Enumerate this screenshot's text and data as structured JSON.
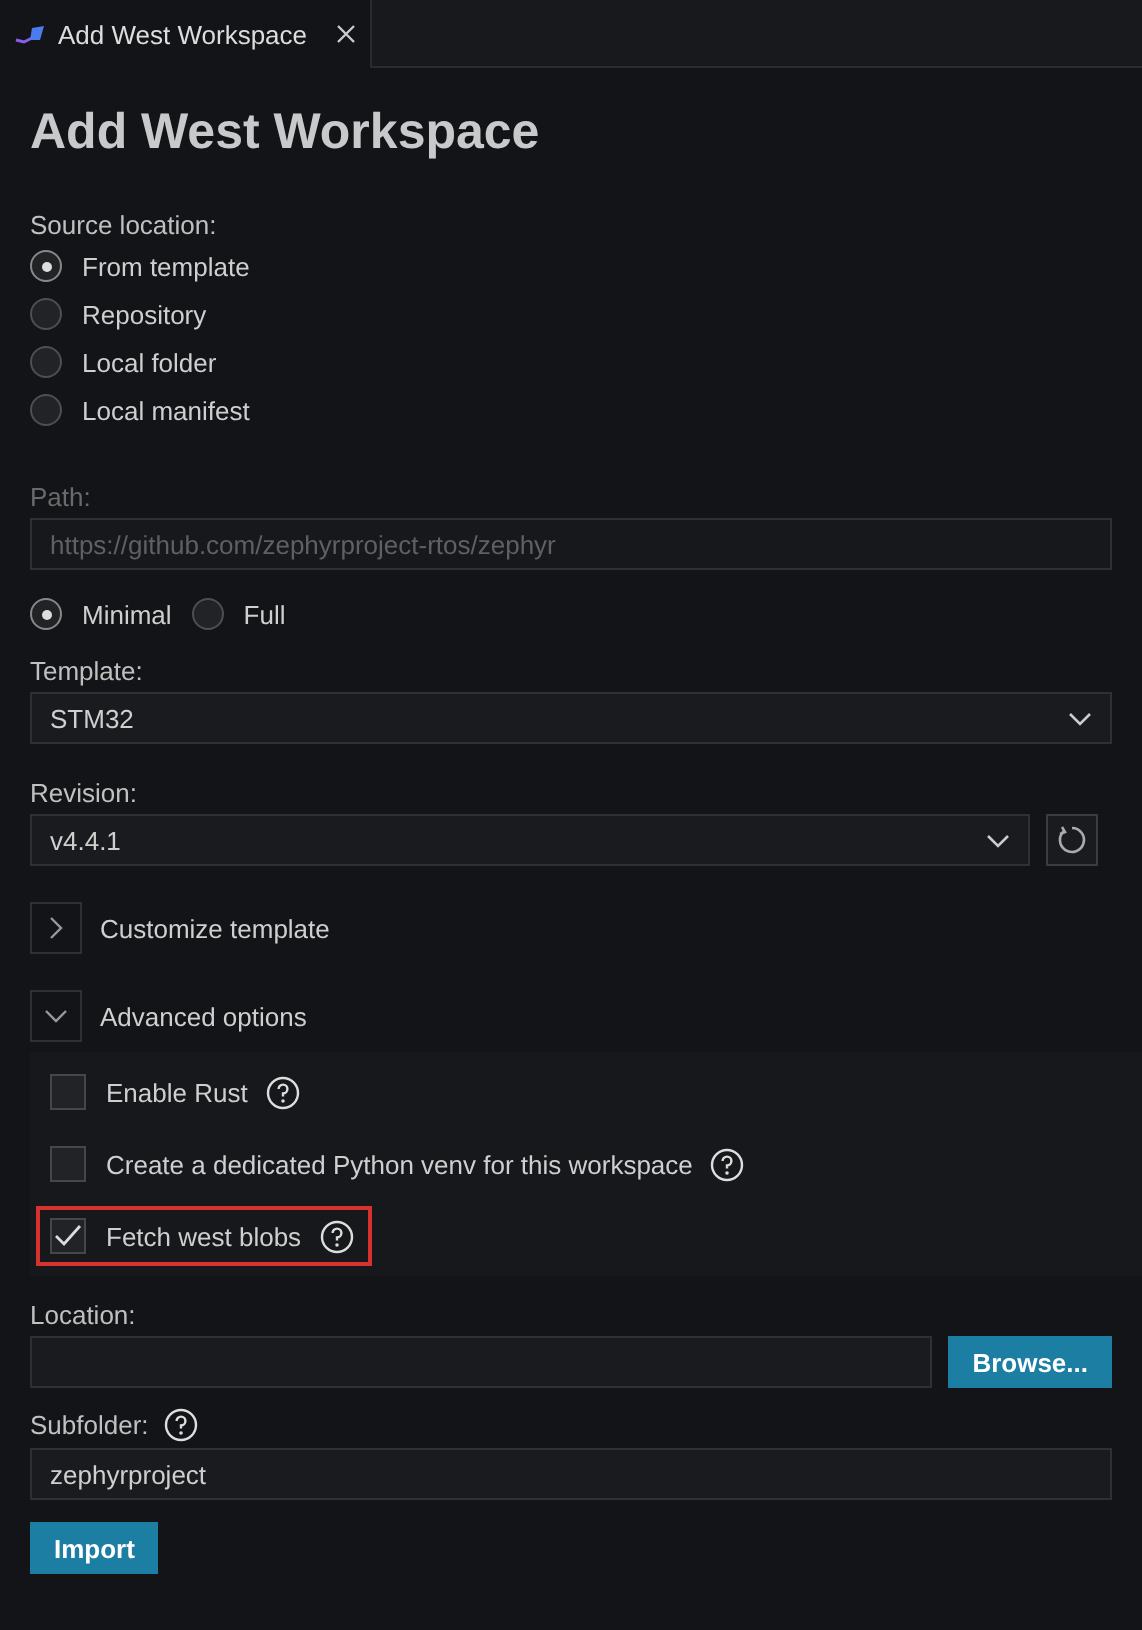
{
  "tab": {
    "title": "Add West Workspace"
  },
  "title": "Add West Workspace",
  "source": {
    "label": "Source location:",
    "options": [
      {
        "label": "From template",
        "selected": true
      },
      {
        "label": "Repository",
        "selected": false
      },
      {
        "label": "Local folder",
        "selected": false
      },
      {
        "label": "Local manifest",
        "selected": false
      }
    ]
  },
  "path": {
    "label": "Path:",
    "placeholder": "https://github.com/zephyrproject-rtos/zephyr",
    "disabled": true
  },
  "clone_mode": [
    {
      "label": "Minimal",
      "selected": true
    },
    {
      "label": "Full",
      "selected": false
    }
  ],
  "template": {
    "label": "Template:",
    "value": "STM32"
  },
  "revision": {
    "label": "Revision:",
    "value": "v4.4.1"
  },
  "sections": [
    {
      "label": "Customize template",
      "expanded": false
    },
    {
      "label": "Advanced options",
      "expanded": true
    }
  ],
  "advanced_options": [
    {
      "label": "Enable Rust",
      "checked": false,
      "highlighted": false
    },
    {
      "label": "Create a dedicated Python venv for this workspace",
      "checked": false,
      "highlighted": false
    },
    {
      "label": "Fetch west blobs",
      "checked": true,
      "highlighted": true
    }
  ],
  "location": {
    "label": "Location:",
    "button": "Browse..."
  },
  "subfolder": {
    "label": "Subfolder:",
    "value": "zephyrproject"
  },
  "import_button": "Import"
}
